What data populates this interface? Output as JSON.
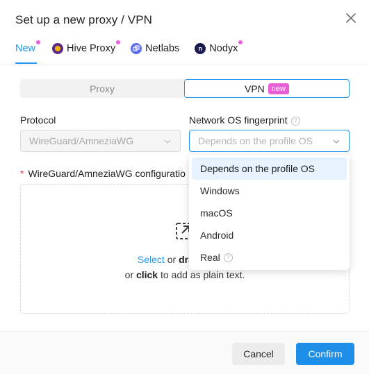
{
  "dialog": {
    "title": "Set up a new proxy / VPN"
  },
  "tabs": [
    {
      "label": "New",
      "active": true,
      "badge_dot": true
    },
    {
      "label": "Hive Proxy",
      "active": false,
      "badge_dot": true,
      "icon": "hive-icon"
    },
    {
      "label": "Netlabs",
      "active": false,
      "badge_dot": false,
      "icon": "netlabs-icon"
    },
    {
      "label": "Nodyx",
      "active": false,
      "badge_dot": true,
      "icon": "nodyx-icon"
    }
  ],
  "segment": {
    "proxy_label": "Proxy",
    "vpn_label": "VPN",
    "vpn_badge": "new",
    "selected": "VPN"
  },
  "protocol": {
    "label": "Protocol",
    "value": "WireGuard/AmneziaWG"
  },
  "fingerprint": {
    "label": "Network OS fingerprint",
    "placeholder": "Depends on the profile OS",
    "options": [
      {
        "label": "Depends on the profile OS",
        "active": true
      },
      {
        "label": "Windows"
      },
      {
        "label": "macOS"
      },
      {
        "label": "Android"
      },
      {
        "label": "Real",
        "help": true
      }
    ]
  },
  "config": {
    "required_mark": "*",
    "label": "WireGuard/AmneziaWG configuratio",
    "select_link": "Select",
    "or_text": " or ",
    "drag_text": "drag and dr",
    "line2_or": "or ",
    "click_text": "click",
    "line2_rest": " to add as plain text."
  },
  "footer": {
    "cancel_label": "Cancel",
    "confirm_label": "Confirm"
  },
  "colors": {
    "accent": "#2196f3",
    "badge": "#e85fd6",
    "confirm_bg": "#1e8fe8"
  }
}
